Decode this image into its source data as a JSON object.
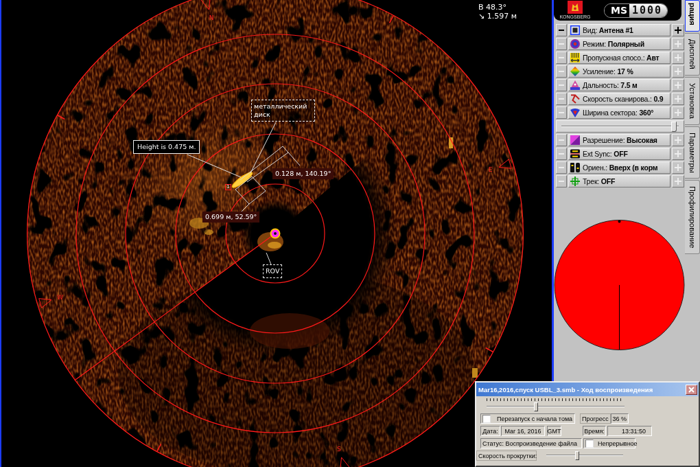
{
  "sonar_view": {
    "readouts": [
      "B 48.3°",
      "↘ 1.597 м"
    ],
    "compass": [
      {
        "kind": "north",
        "label": "N"
      },
      {
        "kind": "east",
        "label": "E"
      },
      {
        "kind": "south",
        "label": "S"
      },
      {
        "kind": "west",
        "label": "W"
      }
    ],
    "annotations": [
      {
        "kind": "note",
        "text": "металлический диск"
      },
      {
        "kind": "callout",
        "text": "Height is 0.475 м."
      },
      {
        "kind": "measurement",
        "text": "0.128 м, 140.19°"
      },
      {
        "kind": "marker",
        "text": "1"
      },
      {
        "kind": "measurement",
        "text": "0.699 м, 52.59°"
      },
      {
        "kind": "note",
        "text": "ROV"
      }
    ]
  },
  "right_panel": {
    "header": {
      "brand": "KONGSBERG",
      "model_prefix": "MS",
      "model_number": "1000"
    },
    "parameters": [
      {
        "kind": "setting",
        "label": "Вид:",
        "value": "Антена #1",
        "disabled": false
      },
      {
        "kind": "setting",
        "label": "Режим:",
        "value": "Полярный",
        "disabled": true
      },
      {
        "kind": "setting",
        "label": "Пропускная спосо.:",
        "value": "Авт",
        "disabled": true
      },
      {
        "kind": "setting",
        "label": "Усиление:",
        "value": "17 %",
        "disabled": true
      },
      {
        "kind": "setting",
        "label": "Дальность:",
        "value": "7.5 м",
        "disabled": true
      },
      {
        "kind": "setting",
        "label": "Скорость сканирова.:",
        "value": "0.9",
        "disabled": true
      },
      {
        "kind": "setting",
        "label": "Ширина сектора:",
        "value": "360°",
        "disabled": true
      },
      {
        "kind": "slider",
        "level": 0.96
      },
      {
        "kind": "setting",
        "label": "Разрешение:",
        "value": "Высокая",
        "disabled": true
      },
      {
        "kind": "setting",
        "label": "Ext Sync:",
        "value": "OFF",
        "disabled": true
      },
      {
        "kind": "setting",
        "label": "Ориен.:",
        "value": "Вверх (в корм",
        "disabled": true
      },
      {
        "kind": "setting",
        "label": "Трек:",
        "value": "OFF",
        "disabled": true
      }
    ],
    "tabs": [
      {
        "label": "рация",
        "selected": true
      },
      {
        "label": "Дисплей",
        "selected": false
      },
      {
        "label": "Установка",
        "selected": false
      },
      {
        "label": "Параметры",
        "selected": false
      },
      {
        "label": "Профилирование",
        "selected": false
      }
    ]
  },
  "playback_dialog": {
    "title": "Mar16,2016,спуск USBL_3.smb - Ход воспроизведения",
    "position_slider": {
      "level": 0.36
    },
    "restart_option": {
      "label": "Перезапуск с начала тома",
      "checked": false
    },
    "progress": {
      "label": "Прогресс",
      "value": "36 %"
    },
    "date": {
      "label": "Дата:",
      "value": "Mar 16, 2016",
      "zone": "GMT"
    },
    "time": {
      "label": "Время:",
      "value": "13:31:50"
    },
    "status": "Статус: Воспроизведение файла",
    "continuous_option": {
      "label": "Непрерывное",
      "checked": false
    },
    "speed": {
      "label": "Скорость прокрутки:",
      "level": 0.4
    }
  }
}
